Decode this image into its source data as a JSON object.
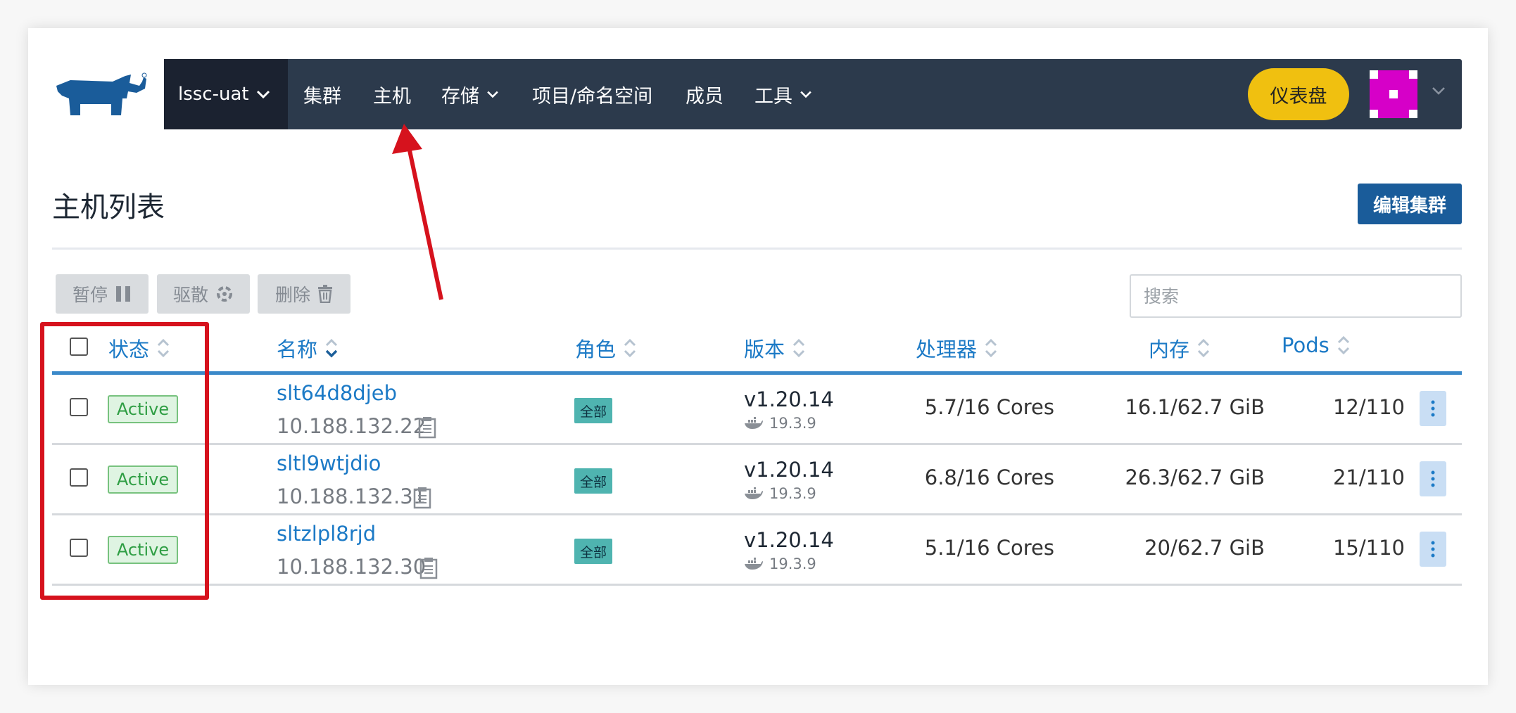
{
  "nav": {
    "cluster_label": "lssc-uat",
    "items": [
      {
        "label": "集群",
        "dropdown": false
      },
      {
        "label": "主机",
        "dropdown": false
      },
      {
        "label": "存储",
        "dropdown": true
      },
      {
        "label": "项目/命名空间",
        "dropdown": false
      },
      {
        "label": "成员",
        "dropdown": false
      },
      {
        "label": "工具",
        "dropdown": true
      }
    ],
    "dashboard_label": "仪表盘"
  },
  "page": {
    "title": "主机列表",
    "edit_cluster_label": "编辑集群"
  },
  "toolbar": {
    "pause_label": "暂停",
    "drain_label": "驱散",
    "delete_label": "删除",
    "search_placeholder": "搜索"
  },
  "table": {
    "headers": {
      "state": "状态",
      "name": "名称",
      "role": "角色",
      "version": "版本",
      "cpu": "处理器",
      "memory": "内存",
      "pods": "Pods"
    },
    "rows": [
      {
        "state": "Active",
        "name": "slt64d8djeb",
        "ip": "10.188.132.22",
        "role": "全部",
        "version": "v1.20.14",
        "docker": "19.3.9",
        "cpu": "5.7/16 Cores",
        "memory": "16.1/62.7 GiB",
        "pods": "12/110"
      },
      {
        "state": "Active",
        "name": "sltl9wtjdio",
        "ip": "10.188.132.31",
        "role": "全部",
        "version": "v1.20.14",
        "docker": "19.3.9",
        "cpu": "6.8/16 Cores",
        "memory": "26.3/62.7 GiB",
        "pods": "21/110"
      },
      {
        "state": "Active",
        "name": "sltzlpl8rjd",
        "ip": "10.188.132.30",
        "role": "全部",
        "version": "v1.20.14",
        "docker": "19.3.9",
        "cpu": "5.1/16 Cores",
        "memory": "20/62.7 GiB",
        "pods": "15/110"
      }
    ]
  },
  "colors": {
    "nav_bg": "#2c3a4c",
    "accent_blue": "#1c7ac6",
    "dashboard_yellow": "#f0c010",
    "annotation_red": "#d6121d",
    "active_green": "#2f9e44"
  }
}
